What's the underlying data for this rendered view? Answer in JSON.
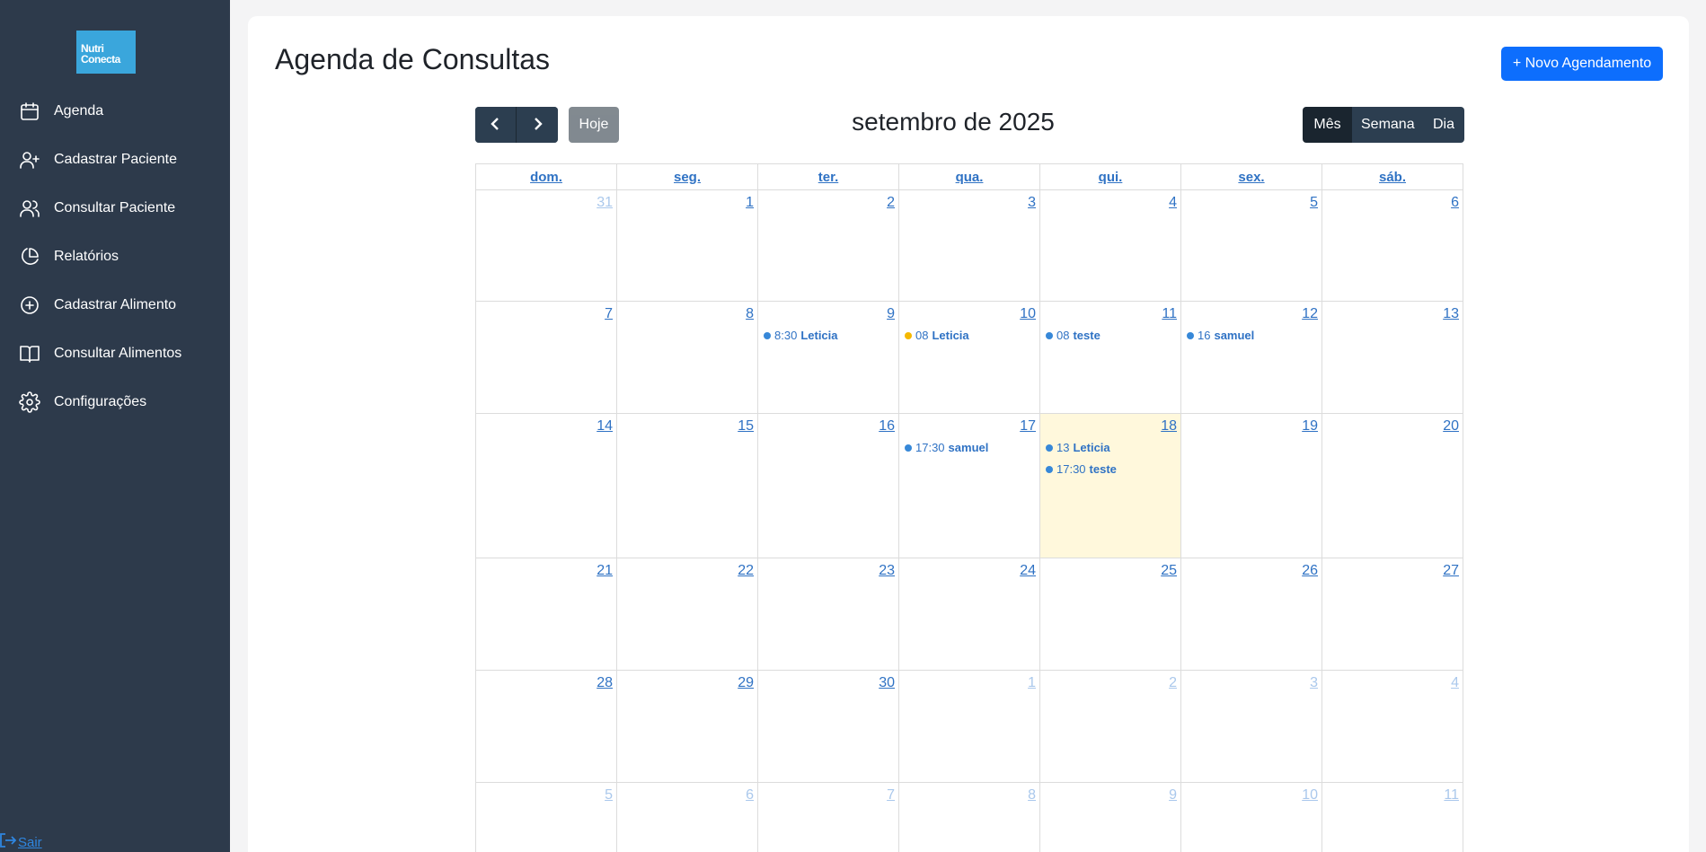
{
  "sidebar": {
    "logo_line1": "Nutri",
    "logo_line2": "Conecta",
    "items": [
      {
        "label": "Agenda",
        "icon": "calendar-icon"
      },
      {
        "label": "Cadastrar Paciente",
        "icon": "user-plus-icon"
      },
      {
        "label": "Consultar Paciente",
        "icon": "users-icon"
      },
      {
        "label": "Relatórios",
        "icon": "pie-chart-icon"
      },
      {
        "label": "Cadastrar Alimento",
        "icon": "plus-circle-icon"
      },
      {
        "label": "Consultar Alimentos",
        "icon": "book-open-icon"
      },
      {
        "label": "Configurações",
        "icon": "gear-icon"
      }
    ],
    "logout_label": "Sair"
  },
  "header": {
    "title": "Agenda de Consultas",
    "new_button": "+ Novo Agendamento"
  },
  "toolbar": {
    "today": "Hoje",
    "month_title": "setembro de 2025",
    "views": [
      "Mês",
      "Semana",
      "Dia"
    ],
    "active_view": "Mês"
  },
  "calendar": {
    "weekdays": [
      "dom.",
      "seg.",
      "ter.",
      "qua.",
      "qui.",
      "sex.",
      "sáb."
    ],
    "today_day": "18",
    "weeks": [
      [
        {
          "d": "31",
          "other": true
        },
        {
          "d": "1"
        },
        {
          "d": "2"
        },
        {
          "d": "3"
        },
        {
          "d": "4"
        },
        {
          "d": "5"
        },
        {
          "d": "6"
        }
      ],
      [
        {
          "d": "7"
        },
        {
          "d": "8"
        },
        {
          "d": "9",
          "events": [
            {
              "time": "8:30",
              "name": "Leticia",
              "color": "#3788d8"
            }
          ]
        },
        {
          "d": "10",
          "events": [
            {
              "time": "08",
              "name": "Leticia",
              "color": "#f5b800"
            }
          ]
        },
        {
          "d": "11",
          "events": [
            {
              "time": "08",
              "name": "teste",
              "color": "#3788d8"
            }
          ]
        },
        {
          "d": "12",
          "events": [
            {
              "time": "16",
              "name": "samuel",
              "color": "#3788d8"
            }
          ]
        },
        {
          "d": "13"
        }
      ],
      [
        {
          "d": "14"
        },
        {
          "d": "15"
        },
        {
          "d": "16"
        },
        {
          "d": "17",
          "events": [
            {
              "time": "17:30",
              "name": "samuel",
              "color": "#3788d8"
            }
          ]
        },
        {
          "d": "18",
          "today": true,
          "events": [
            {
              "time": "13",
              "name": "Leticia",
              "color": "#3788d8"
            },
            {
              "time": "17:30",
              "name": "teste",
              "color": "#3788d8"
            }
          ]
        },
        {
          "d": "19"
        },
        {
          "d": "20"
        }
      ],
      [
        {
          "d": "21"
        },
        {
          "d": "22"
        },
        {
          "d": "23"
        },
        {
          "d": "24"
        },
        {
          "d": "25"
        },
        {
          "d": "26"
        },
        {
          "d": "27"
        }
      ],
      [
        {
          "d": "28"
        },
        {
          "d": "29"
        },
        {
          "d": "30"
        },
        {
          "d": "1",
          "other": true
        },
        {
          "d": "2",
          "other": true
        },
        {
          "d": "3",
          "other": true
        },
        {
          "d": "4",
          "other": true
        }
      ],
      [
        {
          "d": "5",
          "other": true
        },
        {
          "d": "6",
          "other": true
        },
        {
          "d": "7",
          "other": true
        },
        {
          "d": "8",
          "other": true
        },
        {
          "d": "9",
          "other": true
        },
        {
          "d": "10",
          "other": true
        },
        {
          "d": "11",
          "other": true
        }
      ]
    ]
  }
}
